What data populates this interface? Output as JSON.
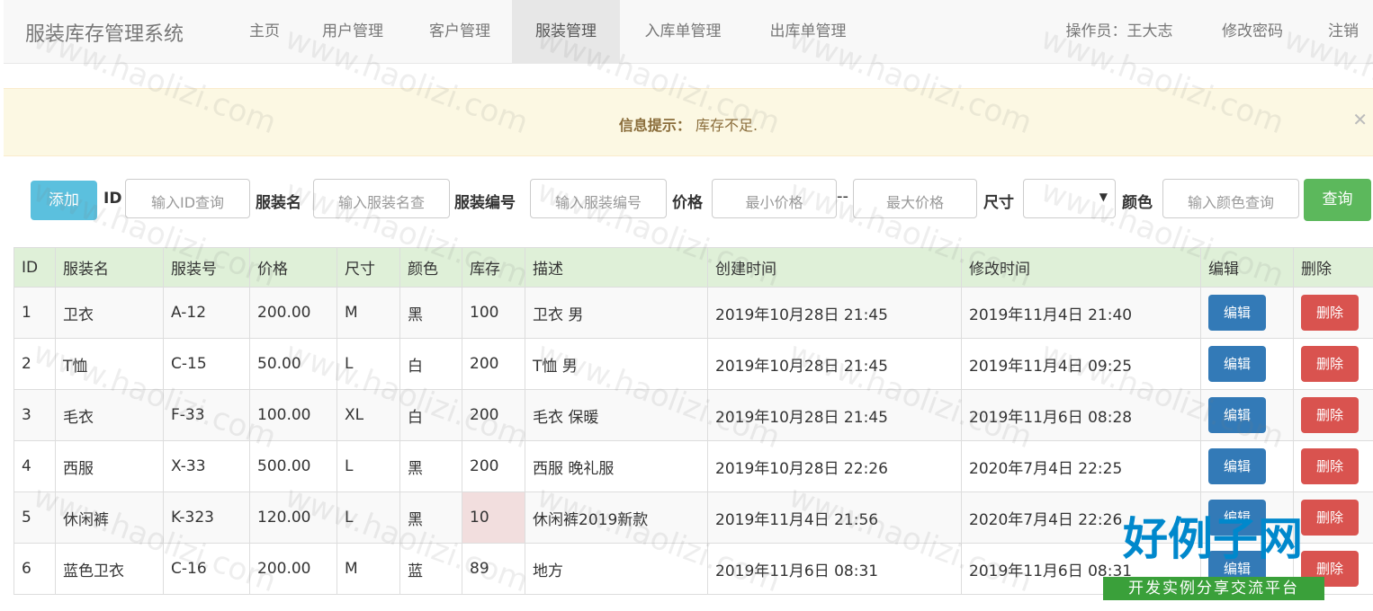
{
  "nav": {
    "brand": "服装库存管理系统",
    "items": [
      "主页",
      "用户管理",
      "客户管理",
      "服装管理",
      "入库单管理",
      "出库单管理"
    ],
    "operator": "操作员：王大志",
    "change_password": "修改密码",
    "logout": "注销"
  },
  "alert": {
    "label": "信息提示：",
    "message": "库存不足."
  },
  "toolbar": {
    "add": "添加",
    "id_label": "ID",
    "id_placeholder": "输入ID查询",
    "name_label": "服装名",
    "name_placeholder": "输入服装名查",
    "code_label": "服装编号",
    "code_placeholder": "输入服装编号",
    "price_label": "价格",
    "min_price_placeholder": "最小价格",
    "dash": "--",
    "max_price_placeholder": "最大价格",
    "size_label": "尺寸",
    "size_value": "",
    "color_label": "颜色",
    "color_placeholder": "输入颜色查询",
    "query": "查询"
  },
  "table": {
    "headers": [
      "ID",
      "服装名",
      "服装号",
      "价格",
      "尺寸",
      "颜色",
      "库存",
      "描述",
      "创建时间",
      "修改时间",
      "编辑",
      "删除"
    ],
    "rows": [
      {
        "id": "1",
        "name": "卫衣",
        "code": "A-12",
        "price": "200.00",
        "size": "M",
        "color": "黑",
        "stock": "100",
        "desc": "卫衣 男",
        "created": "2019年10月28日 21:45",
        "modified": "2019年11月4日 21:40",
        "low": false
      },
      {
        "id": "2",
        "name": "T恤",
        "code": "C-15",
        "price": "50.00",
        "size": "L",
        "color": "白",
        "stock": "200",
        "desc": "T恤 男",
        "created": "2019年10月28日 21:45",
        "modified": "2019年11月4日 09:25",
        "low": false
      },
      {
        "id": "3",
        "name": "毛衣",
        "code": "F-33",
        "price": "100.00",
        "size": "XL",
        "color": "白",
        "stock": "200",
        "desc": "毛衣 保暖",
        "created": "2019年10月28日 21:45",
        "modified": "2019年11月6日 08:28",
        "low": false
      },
      {
        "id": "4",
        "name": "西服",
        "code": "X-33",
        "price": "500.00",
        "size": "L",
        "color": "黑",
        "stock": "200",
        "desc": "西服 晚礼服",
        "created": "2019年10月28日 22:26",
        "modified": "2020年7月4日 22:25",
        "low": false
      },
      {
        "id": "5",
        "name": "休闲裤",
        "code": "K-323",
        "price": "120.00",
        "size": "L",
        "color": "黑",
        "stock": "10",
        "desc": "休闲裤2019新款",
        "created": "2019年11月4日 21:56",
        "modified": "2020年7月4日 22:26",
        "low": true
      },
      {
        "id": "6",
        "name": "蓝色卫衣",
        "code": "C-16",
        "price": "200.00",
        "size": "M",
        "color": "蓝",
        "stock": "89",
        "desc": "地方",
        "created": "2019年11月6日 08:31",
        "modified": "2019年11月6日 08:31",
        "low": false
      }
    ],
    "edit_label": "编辑",
    "delete_label": "删除"
  },
  "watermark": {
    "logo_title": "好例子网",
    "logo_subtitle": "开发实例分享交流平台",
    "tile_text": "www.haolizi.com"
  },
  "colors": {
    "info": "#5bc0de",
    "success": "#5cb85c",
    "primary": "#337ab7",
    "danger": "#d9534f",
    "header_bg": "#dff0d8",
    "alert_bg": "#fcf8e3"
  }
}
